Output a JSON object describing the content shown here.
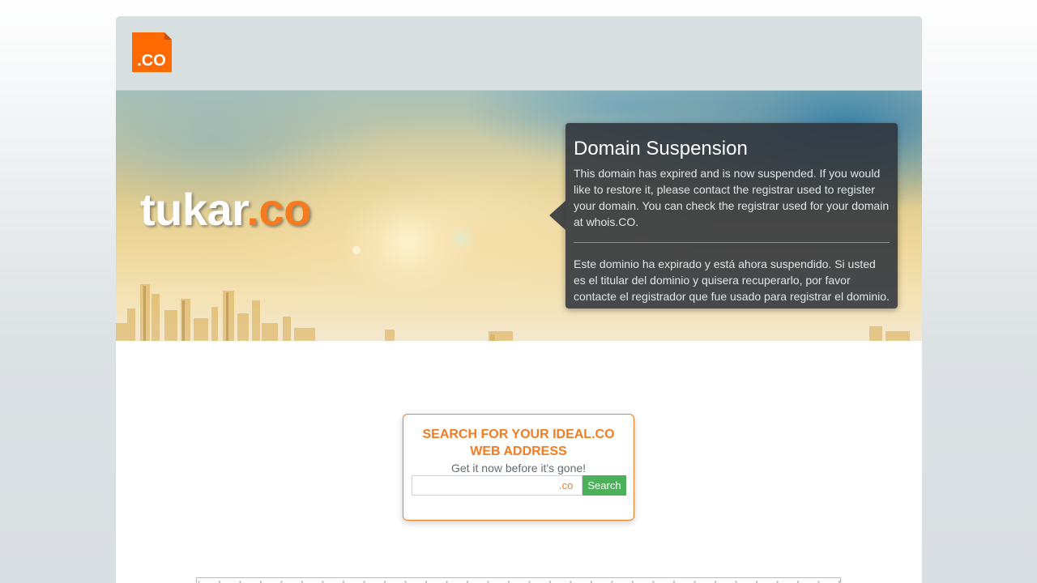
{
  "logo": {
    "text": ".CO",
    "icon": "dot-co-logo-icon",
    "color": "#ff6a00"
  },
  "hero": {
    "domain_base": "tukar",
    "domain_tld": ".co"
  },
  "notice": {
    "title": "Domain Suspension",
    "text_en": "This domain has expired and is now suspended. If you would like to restore it, please contact the registrar used to register your domain. You can check the registrar used for your domain at whois.CO.",
    "text_es": "Este dominio ha expirado y está ahora suspendido. Si usted es el titular del dominio y quisera recuperarlo, por favor contacte el registrador que fue usado para registrar el dominio."
  },
  "search": {
    "title": "SEARCH FOR YOUR IDEAL.CO WEB ADDRESS",
    "subtitle": "Get it now before it's gone!",
    "input_value": "",
    "input_placeholder": "",
    "tld_suffix": ".co",
    "button_label": "Search"
  },
  "colors": {
    "accent": "#f47b20",
    "button": "#4cb05b",
    "topbar": "#d7dfe1",
    "notice_bg": "#2d323a"
  }
}
